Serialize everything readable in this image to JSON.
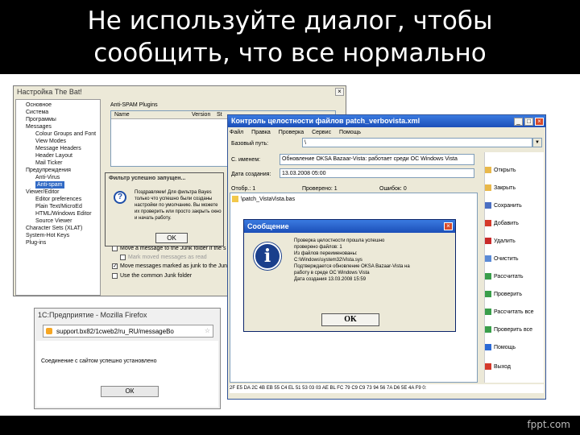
{
  "slide": {
    "title_line1": "Не используйте диалог, чтобы",
    "title_line2": "сообщить, что все нормально",
    "brand": "fppt.com"
  },
  "settings_window": {
    "title": "Настройка The Bat!",
    "tree": [
      "Основное",
      "Система",
      "Программы",
      "Messages",
      "Colour Groups and Font",
      "View Modes",
      "Message Headers",
      "Header Layout",
      "Mail Ticker",
      "Предупреждения",
      "Anti-Virus",
      "Anti-spam",
      "Viewer/Editor",
      "Editor preferences",
      "Plain Text/MicroEd",
      "HTML/Windows Editor",
      "Source Viewer",
      "Character Sets (XLAT)",
      "System-Hot Keys",
      "Plug-ins"
    ],
    "plugins_group": "Anti-SPAM Plugins",
    "plugins_columns": [
      "Name",
      "Version",
      "St"
    ],
    "options": [
      {
        "label": "Move a message to the Junk folder if the s",
        "checked": false
      },
      {
        "label": "Mark moved messages as read",
        "checked": false
      },
      {
        "label": "Move messages marked as junk to the Junk fo",
        "checked": true
      },
      {
        "label": "Use the common Junk folder",
        "checked": false
      }
    ],
    "colors": {
      "tree_select": "#316ac5"
    }
  },
  "filter_dialog": {
    "title": "Фильтр успешно запущен...",
    "message": "Поздравляем! Для фильтра Bayes только что успешно были созданы настройки по умолчанию. Вы можете их проверить или просто закрыть окно и начать работу.",
    "ok_label": "OK"
  },
  "integrity_window": {
    "title": "Контроль целостности файлов patch_verbovista.xml",
    "menu": [
      "Файл",
      "Правка",
      "Проверка",
      "Сервис",
      "Помощь"
    ],
    "path_label": "Базовый путь:",
    "path_value": "\\",
    "name_label": "С. именем:",
    "name_value": "Обновление OKSA Bazaar-Vista: работает среди OC Windows Vista",
    "date_label": "Дата создания:",
    "date_value": "13.03.2008  05:00",
    "counts": [
      {
        "label": "Отобр.: 1"
      },
      {
        "label": "Проверено: 1"
      },
      {
        "label": "Ошибок: 0"
      }
    ],
    "list_item": "\\patch_VistaVista.bas",
    "sidebar": [
      "Открыть",
      "Закрыть",
      "Сохранить",
      "Добавить",
      "Удалить",
      "Очистить",
      "Рассчитать",
      "Проверить",
      "Рассчитать все",
      "Проверить все",
      "Помощь",
      "Выход"
    ],
    "hex_line": "2F E5 DA 2C 4B EB 55 C4 EL 51 53 03 03 AE BL FC 79 C9 C9 73 94 56 7A D6 5E 4A F9 0:",
    "colors": {
      "title_bar": "#1c4fb8"
    }
  },
  "message_dialog": {
    "title": "Сообщение",
    "text": "Проверка целостности прошла успешно\nпроверено файлов: 1\nИз файлов переименованы:\nС:\\Windows\\system32\\Vista.sys\nПодтверждается обновление OKSA Bazaar-Vista на\nработу в среде OC Windows Vista\nДата создания 13.03.2008 15:59",
    "ok_label": "OK"
  },
  "firefox_dialog": {
    "title": "1С:Предприятие - Mozilla Firefox",
    "url": "support.bx82/1cweb2/ru_RU/messageBo",
    "message": "Соединение с сайтом успешно установлено",
    "ok_label": "ОК"
  }
}
